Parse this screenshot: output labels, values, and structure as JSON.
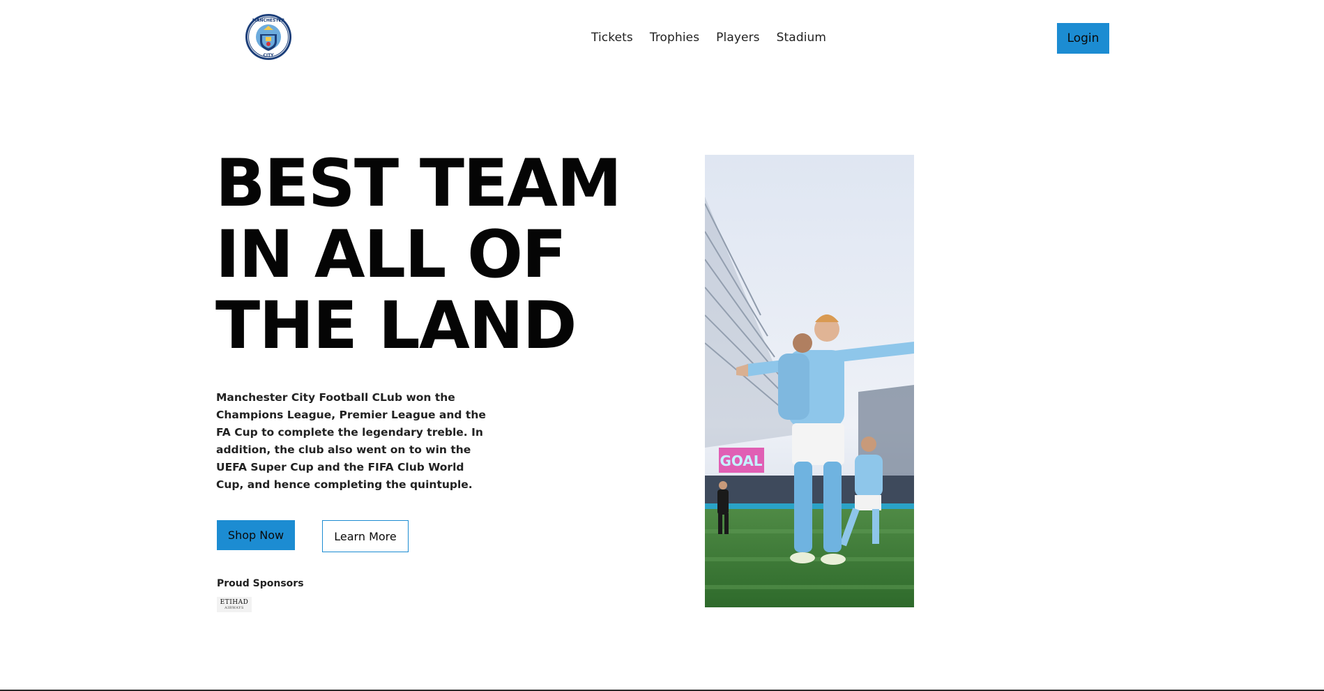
{
  "header": {
    "logo_alt": "MANCHESTER CITY",
    "logo_text_top": "MANCHESTER",
    "logo_text_bottom": "CITY",
    "nav": [
      "Tickets",
      "Trophies",
      "Players",
      "Stadium"
    ],
    "login_label": "Login"
  },
  "hero": {
    "title_lines": [
      "BEST TEAM",
      "IN ALL OF",
      "THE LAND"
    ],
    "description": "Manchester City Football CLub won the Champions League, Premier League and the FA Cup to complete the legendary treble. In addition, the club also went on to win the UEFA Super Cup and the FIFA Club World Cup, and hence completing the quintuple.",
    "shop_label": "Shop Now",
    "learn_label": "Learn More",
    "sponsors_label": "Proud Sponsors",
    "sponsor_logo_text": "ETIHAD",
    "sponsor_logo_subtext": "AIRWAYS",
    "image_board_text": "GOAL"
  },
  "colors": {
    "accent": "#1c8cd2",
    "text": "#050505",
    "sky_blue": "#8ec6ea",
    "pitch": "#3d7a3a"
  },
  "icons": {
    "logo": "club-crest-icon",
    "sponsor": "sponsor-logo-icon"
  }
}
